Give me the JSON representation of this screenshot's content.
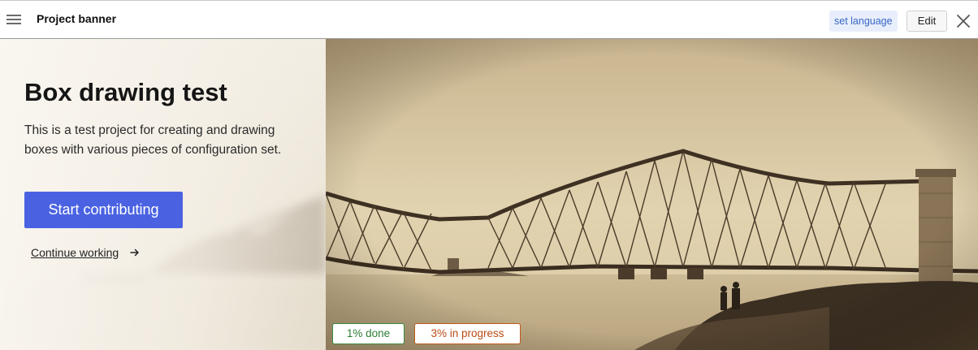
{
  "header": {
    "menu_icon": "hamburger-icon",
    "title": "Project banner",
    "set_language_label": "set language",
    "edit_label": "Edit",
    "close_icon": "close-icon"
  },
  "banner": {
    "title": "Box drawing test",
    "description": "This is a test project for creating and drawing boxes with various pieces of configuration set.",
    "start_button_label": "Start contributing",
    "continue_link_label": "Continue working",
    "continue_icon": "arrow-right-icon",
    "image_subject": "sepia photograph of a cantilever railway bridge over water",
    "primary_color": "#4a62e2"
  },
  "progress": {
    "done_label": "1% done",
    "done_color": "#2e7d32",
    "in_progress_label": "3% in progress",
    "in_progress_color": "#b94b12"
  }
}
